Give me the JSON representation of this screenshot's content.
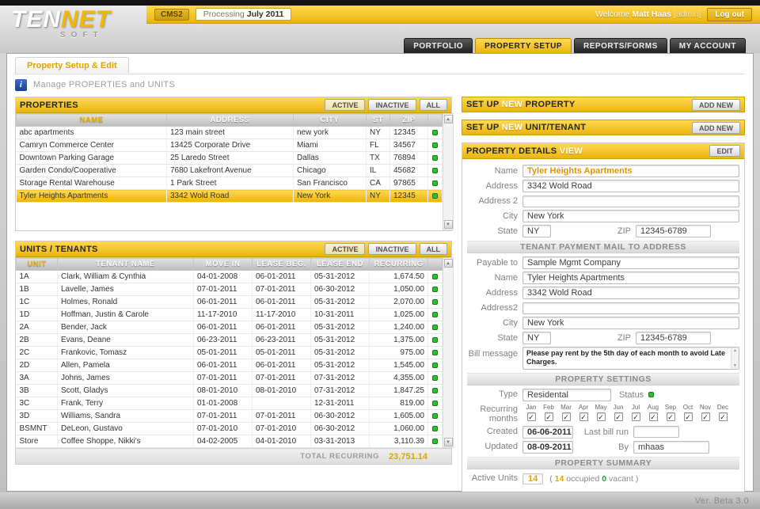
{
  "colors": {
    "gold": "#e9b411",
    "green": "#2ec12e",
    "accent_text": "#e0a400"
  },
  "icons": {
    "info": "i",
    "scroll_up": "▲",
    "scroll_down": "▼",
    "check": "✓"
  },
  "header": {
    "logo_part1": "TEN",
    "logo_part2": "NET",
    "logo_sub": "SOFT",
    "cms_badge": "CMS2",
    "processing_label": "Processing",
    "processing_value": "July 2011",
    "welcome_label": "Welcome",
    "user_name": "Matt Haas",
    "user_role": "[admin]",
    "logout": "Log out"
  },
  "nav": {
    "tabs": [
      {
        "label": "PORTFOLIO"
      },
      {
        "label": "PROPERTY SETUP"
      },
      {
        "label": "REPORTS/FORMS"
      },
      {
        "label": "MY ACCOUNT"
      }
    ]
  },
  "subnav": {
    "active_tab": "Property Setup & Edit"
  },
  "info_bar": {
    "text": "Manage PROPERTIES and UNITS"
  },
  "properties_panel": {
    "title": "PROPERTIES",
    "filters": [
      "ACTIVE",
      "INACTIVE",
      "ALL"
    ],
    "columns": [
      "NAME",
      "ADDRESS",
      "CITY",
      "ST",
      "ZIP"
    ],
    "rows": [
      {
        "name": "abc apartments",
        "address": "123 main street",
        "city": "new york",
        "st": "NY",
        "zip": "12345",
        "selected": false
      },
      {
        "name": "Camryn Commerce Center",
        "address": "13425 Corporate Drive",
        "city": "Miami",
        "st": "FL",
        "zip": "34567",
        "selected": false
      },
      {
        "name": "Downtown Parking Garage",
        "address": "25 Laredo Street",
        "city": "Dallas",
        "st": "TX",
        "zip": "76894",
        "selected": false
      },
      {
        "name": "Garden Condo/Cooperative",
        "address": "7680 Lakefront Avenue",
        "city": "Chicago",
        "st": "IL",
        "zip": "45682",
        "selected": false
      },
      {
        "name": "Storage Rental Warehouse",
        "address": "1 Park Street",
        "city": "San Francisco",
        "st": "CA",
        "zip": "97865",
        "selected": false
      },
      {
        "name": "Tyler Heights Apartments",
        "address": "3342 Wold Road",
        "city": "New York",
        "st": "NY",
        "zip": "12345",
        "selected": true
      }
    ]
  },
  "units_panel": {
    "title": "UNITS / TENANTS",
    "filters": [
      "ACTIVE",
      "INACTIVE",
      "ALL"
    ],
    "columns": [
      "UNIT",
      "TENANT NAME",
      "MOVE IN",
      "LEASE BEG.",
      "LEASE END",
      "RECURRING"
    ],
    "rows": [
      {
        "unit": "1A",
        "tenant": "Clark, William & Cynthia",
        "move_in": "04-01-2008",
        "lease_beg": "06-01-2011",
        "lease_end": "05-31-2012",
        "recurring": "1,674.50"
      },
      {
        "unit": "1B",
        "tenant": "Lavelle, James",
        "move_in": "07-01-2011",
        "lease_beg": "07-01-2011",
        "lease_end": "06-30-2012",
        "recurring": "1,050.00"
      },
      {
        "unit": "1C",
        "tenant": "Holmes, Ronald",
        "move_in": "06-01-2011",
        "lease_beg": "06-01-2011",
        "lease_end": "05-31-2012",
        "recurring": "2,070.00"
      },
      {
        "unit": "1D",
        "tenant": "Hoffman, Justin & Carole",
        "move_in": "11-17-2010",
        "lease_beg": "11-17-2010",
        "lease_end": "10-31-2011",
        "recurring": "1,025.00"
      },
      {
        "unit": "2A",
        "tenant": "Bender, Jack",
        "move_in": "06-01-2011",
        "lease_beg": "06-01-2011",
        "lease_end": "05-31-2012",
        "recurring": "1,240.00"
      },
      {
        "unit": "2B",
        "tenant": "Evans, Deane",
        "move_in": "06-23-2011",
        "lease_beg": "06-23-2011",
        "lease_end": "05-31-2012",
        "recurring": "1,375.00"
      },
      {
        "unit": "2C",
        "tenant": "Frankovic, Tomasz",
        "move_in": "05-01-2011",
        "lease_beg": "05-01-2011",
        "lease_end": "05-31-2012",
        "recurring": "975.00"
      },
      {
        "unit": "2D",
        "tenant": "Allen, Pamela",
        "move_in": "06-01-2011",
        "lease_beg": "06-01-2011",
        "lease_end": "05-31-2012",
        "recurring": "1,545.00"
      },
      {
        "unit": "3A",
        "tenant": "Johns, James",
        "move_in": "07-01-2011",
        "lease_beg": "07-01-2011",
        "lease_end": "07-31-2012",
        "recurring": "4,355.00"
      },
      {
        "unit": "3B",
        "tenant": "Scott, Gladys",
        "move_in": "08-01-2010",
        "lease_beg": "08-01-2010",
        "lease_end": "07-31-2012",
        "recurring": "1,847.25"
      },
      {
        "unit": "3C",
        "tenant": "Frank, Terry",
        "move_in": "01-01-2008",
        "lease_beg": "",
        "lease_end": "12-31-2011",
        "recurring": "819.00"
      },
      {
        "unit": "3D",
        "tenant": "Williams, Sandra",
        "move_in": "07-01-2011",
        "lease_beg": "07-01-2011",
        "lease_end": "06-30-2012",
        "recurring": "1,605.00"
      },
      {
        "unit": "BSMNT",
        "tenant": "DeLeon, Gustavo",
        "move_in": "07-01-2010",
        "lease_beg": "07-01-2010",
        "lease_end": "06-30-2012",
        "recurring": "1,060.00"
      },
      {
        "unit": "Store",
        "tenant": "Coffee Shoppe, Nikki's",
        "move_in": "04-02-2005",
        "lease_beg": "04-01-2010",
        "lease_end": "03-31-2013",
        "recurring": "3,110.39"
      }
    ],
    "total_label": "TOTAL RECURRING",
    "total_value": "23,751.14"
  },
  "setup_property": {
    "title_pre": "SET UP",
    "title_accent": "NEW",
    "title_post": "PROPERTY",
    "button": "ADD NEW"
  },
  "setup_unit": {
    "title_pre": "SET UP",
    "title_accent": "NEW",
    "title_post": "UNIT/TENANT",
    "button": "ADD NEW"
  },
  "details": {
    "title_pre": "PROPERTY DETAILS",
    "title_accent": "VIEW",
    "edit_button": "EDIT",
    "labels": {
      "name": "Name",
      "address": "Address",
      "address2": "Address 2",
      "city": "City",
      "state": "State",
      "zip": "ZIP"
    },
    "values": {
      "name": "Tyler Heights Apartments",
      "address": "3342 Wold Road",
      "address2": "",
      "city": "New York",
      "state": "NY",
      "zip": "12345-6789"
    },
    "mail": {
      "header": "TENANT PAYMENT MAIL TO ADDRESS",
      "labels": {
        "payable": "Payable to",
        "name": "Name",
        "address": "Address",
        "address2": "Address2",
        "city": "City",
        "state": "State",
        "zip": "ZIP",
        "bill": "Bill message"
      },
      "values": {
        "payable": "Sample Mgmt Company",
        "name": "Tyler Heights Apartments",
        "address": "3342 Wold Road",
        "address2": "",
        "city": "New York",
        "state": "NY",
        "zip": "12345-6789",
        "bill": "Please pay rent by the 5th day of each month to avoid Late Charges."
      }
    },
    "settings": {
      "header": "PROPERTY SETTINGS",
      "type_label": "Type",
      "type_value": "Residental",
      "status_label": "Status",
      "recurring_label_1": "Recurring",
      "recurring_label_2": "months",
      "months": [
        "Jan",
        "Feb",
        "Mar",
        "Apr",
        "May",
        "Jun",
        "Jul",
        "Aug",
        "Sep",
        "Oct",
        "Nov",
        "Dec"
      ],
      "created_label": "Created",
      "created_value": "06-06-2011",
      "last_bill_label": "Last bill run",
      "last_bill_value": "",
      "updated_label": "Updated",
      "updated_value": "08-09-2011",
      "by_label": "By",
      "by_value": "mhaas"
    },
    "summary": {
      "header": "PROPERTY SUMMARY",
      "active_units_label": "Active Units",
      "active_units_value": "14",
      "paren_open": "(",
      "occupied_value": "14",
      "occupied_label": "occupied",
      "vacant_value": "0",
      "vacant_label": "vacant",
      "paren_close": ")"
    }
  },
  "footer": {
    "version": "Ver. Beta 3.0"
  }
}
